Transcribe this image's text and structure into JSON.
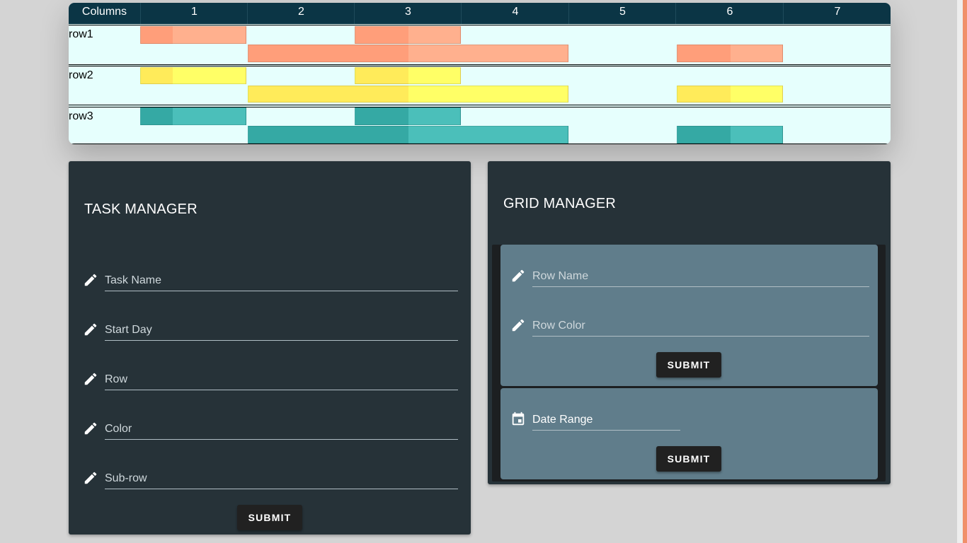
{
  "grid": {
    "header": {
      "first": "Columns",
      "columns": [
        "1",
        "2",
        "3",
        "4",
        "5",
        "6",
        "7"
      ]
    },
    "rows": [
      {
        "label": "row1",
        "dark": "#ff9e7a",
        "light": "#ffb08e"
      },
      {
        "label": "row2",
        "dark": "#ffeb5a",
        "light": "#ffff66"
      },
      {
        "label": "row3",
        "dark": "#35a9a4",
        "light": "#4bbfba"
      }
    ]
  },
  "task_manager": {
    "title": "TASK MANAGER",
    "fields": {
      "task_name": "Task Name",
      "start_day": "Start Day",
      "row": "Row",
      "color": "Color",
      "sub_row": "Sub-row"
    },
    "submit": "SUBMIT"
  },
  "grid_manager": {
    "title": "GRID MANAGER",
    "row_card": {
      "row_name": "Row Name",
      "row_color": "Row Color",
      "submit": "SUBMIT"
    },
    "date_card": {
      "date_range": "Date Range",
      "submit": "SUBMIT"
    }
  },
  "icons": {
    "pencil": "pencil-icon",
    "calendar": "calendar-icon"
  }
}
